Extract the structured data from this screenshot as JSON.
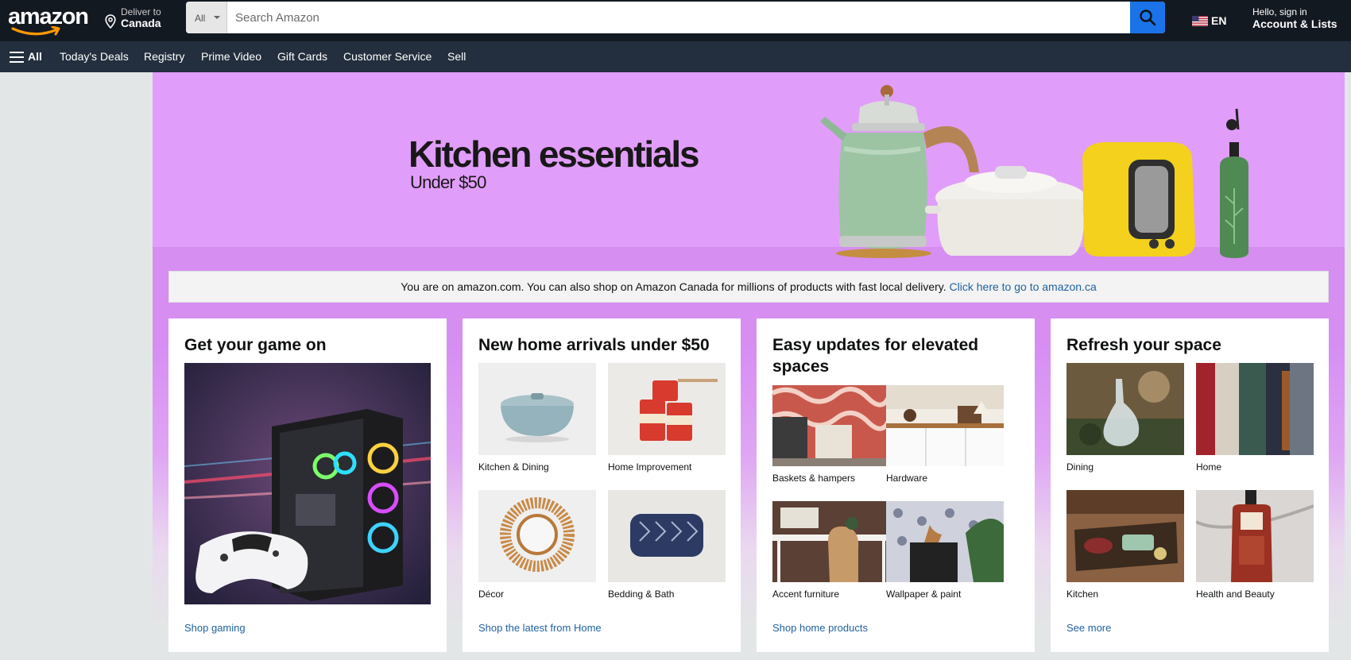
{
  "header": {
    "logo_text": "amazon",
    "deliver_line1": "Deliver to",
    "deliver_line2": "Canada",
    "search_category": "All",
    "search_placeholder": "Search Amazon",
    "language": "EN",
    "account_line1": "Hello, sign in",
    "account_line2": "Account & Lists"
  },
  "subnav": {
    "all_label": "All",
    "items": [
      "Today's Deals",
      "Registry",
      "Prime Video",
      "Gift Cards",
      "Customer Service",
      "Sell"
    ]
  },
  "hero": {
    "title": "Kitchen essentials",
    "subtitle": "Under $50"
  },
  "notice": {
    "text": "You are on amazon.com. You can also shop on Amazon Canada for millions of products with fast local delivery. ",
    "link": "Click here to go to amazon.ca"
  },
  "cards": [
    {
      "title": "Get your game on",
      "footer": "Shop gaming"
    },
    {
      "title": "New home arrivals under $50",
      "footer": "Shop the latest from Home",
      "tiles": [
        "Kitchen & Dining",
        "Home Improvement",
        "Décor",
        "Bedding & Bath"
      ]
    },
    {
      "title": "Easy updates for elevated spaces",
      "footer": "Shop home products",
      "tiles": [
        "Baskets & hampers",
        "Hardware",
        "Accent furniture",
        "Wallpaper & paint"
      ]
    },
    {
      "title": "Refresh your space",
      "footer": "See more",
      "tiles": [
        "Dining",
        "Home",
        "Kitchen",
        "Health and Beauty"
      ]
    }
  ],
  "colors": {
    "nav_bg": "#131921",
    "subnav_bg": "#232f3e",
    "search_button": "#1a73e8",
    "hero_bg": "#e19dfa",
    "link": "#2162a1"
  },
  "icons": [
    "amazon-smile-arrow-icon",
    "location-pin-icon",
    "dropdown-caret-icon",
    "search-icon",
    "us-flag-icon",
    "hamburger-menu-icon"
  ]
}
